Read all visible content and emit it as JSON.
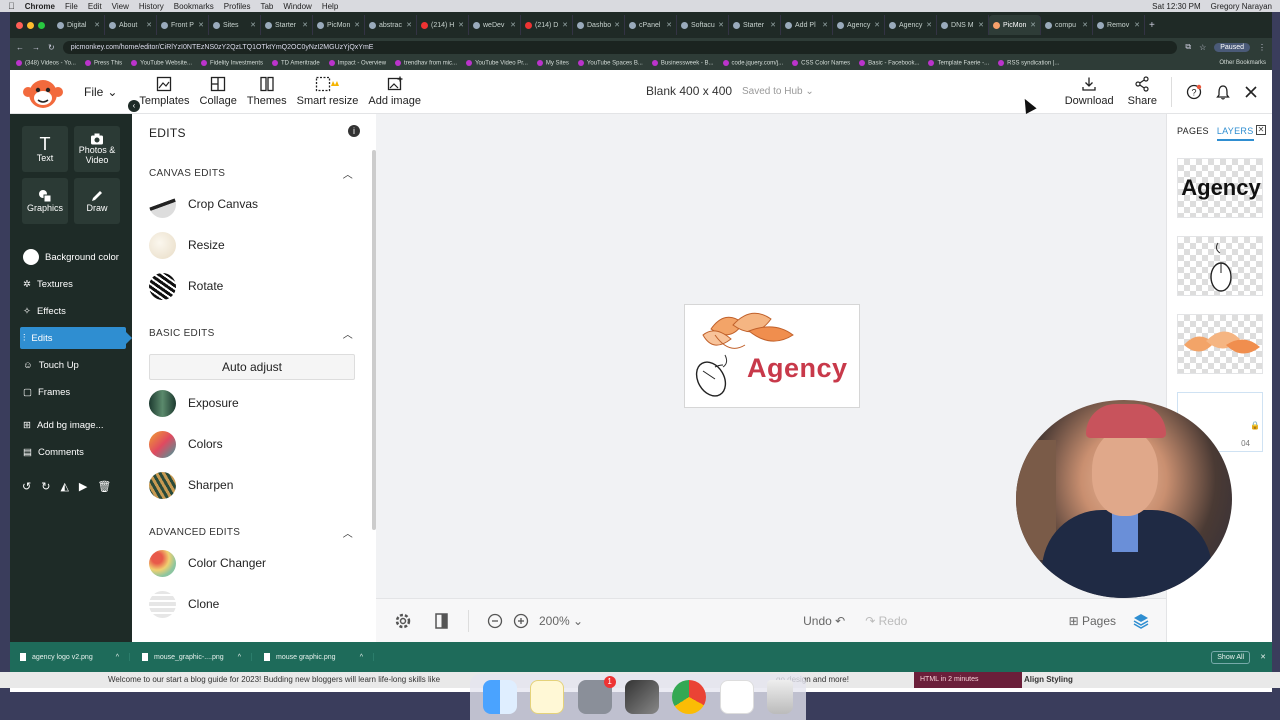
{
  "menubar": {
    "app": "Chrome",
    "items": [
      "File",
      "Edit",
      "View",
      "History",
      "Bookmarks",
      "Profiles",
      "Tab",
      "Window",
      "Help"
    ],
    "datetime": "Sat 12:30 PM",
    "user": "Gregory Narayan"
  },
  "browser": {
    "tabs": [
      "Digital",
      "About",
      "Front P",
      "Sites",
      "Starter",
      "PicMon",
      "abstrac",
      "(214) H",
      "weDev",
      "(214) D",
      "Dashbo",
      "cPanel",
      "Softacu",
      "Starter",
      "Add Pl",
      "Agency",
      "Agency",
      "DNS M",
      "PicMon",
      "compu",
      "Remov"
    ],
    "active_tab": 18,
    "url": "picmonkey.com/home/editor/CiRlYzI0NTEzNS0zY2QzLTQ1OTktYmQ2OC0yNzI2MGUzYjQxYmE",
    "paused": "Paused",
    "bookmarks": [
      "(348) Videos - Yo...",
      "Press This",
      "YouTube Website...",
      "Fidelity Investments",
      "TD Ameritrade",
      "Impact - Overview",
      "trendhav from mic...",
      "YouTube Video Pr...",
      "My Sites",
      "YouTube Spaces B...",
      "Businessweek - B...",
      "code.jquery.com/j...",
      "CSS Color Names",
      "Basic - Facebook...",
      "Template Faerie -...",
      "RSS syndication |..."
    ],
    "other_bookmarks": "Other Bookmarks"
  },
  "toolbar": {
    "file": "File",
    "tools": [
      "Templates",
      "Collage",
      "Themes",
      "Smart resize",
      "Add image"
    ],
    "doc_title": "Blank 400 x 400",
    "saved": "Saved to Hub",
    "download": "Download",
    "share": "Share"
  },
  "rail": {
    "text": "Text",
    "photos": "Photos & Video",
    "graphics": "Graphics",
    "draw": "Draw",
    "items": [
      "Background color",
      "Textures",
      "Effects",
      "Edits",
      "Touch Up",
      "Frames",
      "Add bg image...",
      "Comments"
    ],
    "active": "Edits"
  },
  "panel": {
    "title": "EDITS",
    "canvas_edits": "CANVAS EDITS",
    "canvas_items": [
      "Crop Canvas",
      "Resize",
      "Rotate"
    ],
    "basic_edits": "BASIC EDITS",
    "auto_adjust": "Auto adjust",
    "basic_items": [
      "Exposure",
      "Colors",
      "Sharpen"
    ],
    "advanced_edits": "ADVANCED EDITS",
    "advanced_items": [
      "Color Changer",
      "Clone"
    ]
  },
  "canvas": {
    "logo_text": "Agency"
  },
  "bottombar": {
    "zoom": "200%",
    "undo": "Undo",
    "redo": "Redo",
    "pages": "Pages"
  },
  "layers": {
    "pages_tab": "PAGES",
    "layers_tab": "LAYERS",
    "thumb_text": "Agency",
    "partial_label": "04"
  },
  "downloads": {
    "files": [
      "agency logo v2.png",
      "mouse_graphic-....png",
      "mouse graphic.png"
    ],
    "show_all": "Show All"
  },
  "background": {
    "blog_text": "Welcome to our start a blog guide for 2023! Budding new bloggers will learn life-long skills like",
    "blog_text2": "go design and more!",
    "promo": "HTML in 2 minutes",
    "align": "Align Styling"
  },
  "dock": {
    "badge": "1"
  },
  "colors": {
    "accent": "#2f8ed1",
    "rail_bg": "#1e2b27",
    "logo_red": "#c8394a",
    "shelf_bg": "#1e6b5a"
  }
}
